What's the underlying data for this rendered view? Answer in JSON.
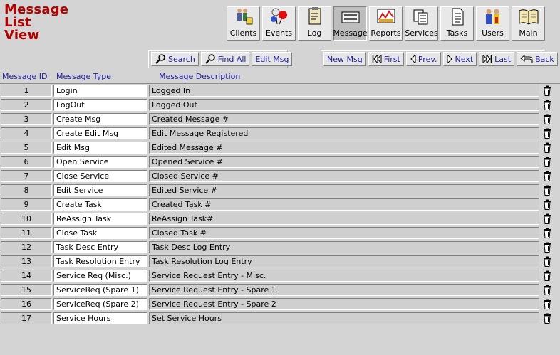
{
  "page": {
    "title_lines": [
      "Message",
      "List",
      "View"
    ]
  },
  "nav": [
    {
      "label": "Clients",
      "icon": "clients-icon",
      "active": false
    },
    {
      "label": "Events",
      "icon": "events-icon",
      "active": false
    },
    {
      "label": "Log",
      "icon": "log-icon",
      "active": false
    },
    {
      "label": "Message",
      "icon": "message-icon",
      "active": true
    },
    {
      "label": "Reports",
      "icon": "reports-icon",
      "active": false
    },
    {
      "label": "Services",
      "icon": "services-icon",
      "active": false
    },
    {
      "label": "Tasks",
      "icon": "tasks-icon",
      "active": false
    },
    {
      "label": "Users",
      "icon": "users-icon",
      "active": false
    },
    {
      "label": "Main",
      "icon": "main-icon",
      "active": false
    }
  ],
  "toolbar": {
    "search": "Search",
    "find_all": "Find All",
    "edit_msg": "Edit Msg",
    "new_msg": "New Msg",
    "first": "First",
    "prev": "Prev.",
    "next": "Next",
    "last": "Last",
    "back": "Back"
  },
  "columns": {
    "id": "Message ID",
    "type": "Message Type",
    "desc": "Message Description"
  },
  "rows": [
    {
      "id": "1",
      "type": "Login",
      "desc": "Logged In"
    },
    {
      "id": "2",
      "type": "LogOut",
      "desc": "Logged Out"
    },
    {
      "id": "3",
      "type": "Create Msg",
      "desc": "Created Message #"
    },
    {
      "id": "4",
      "type": "Create Edit Msg",
      "desc": "Edit Message Registered"
    },
    {
      "id": "5",
      "type": "Edit Msg",
      "desc": "Edited Message #"
    },
    {
      "id": "6",
      "type": "Open Service",
      "desc": "Opened Service #"
    },
    {
      "id": "7",
      "type": "Close Service",
      "desc": "Closed Service #"
    },
    {
      "id": "8",
      "type": "Edit Service",
      "desc": "Edited Service #"
    },
    {
      "id": "9",
      "type": "Create Task",
      "desc": "Created Task #"
    },
    {
      "id": "10",
      "type": "ReAssign Task",
      "desc": "ReAssign Task#"
    },
    {
      "id": "11",
      "type": "Close Task",
      "desc": "Closed Task #"
    },
    {
      "id": "12",
      "type": "Task Desc Entry",
      "desc": "Task Desc Log Entry"
    },
    {
      "id": "13",
      "type": "Task Resolution Entry",
      "desc": "Task Resolution Log Entry"
    },
    {
      "id": "14",
      "type": "Service Req (Misc.)",
      "desc": "Service Request Entry - Misc."
    },
    {
      "id": "15",
      "type": "ServiceReq (Spare 1)",
      "desc": "Service Request Entry - Spare 1"
    },
    {
      "id": "16",
      "type": "ServiceReq (Spare 2)",
      "desc": "Service Request Entry - Spare 2"
    },
    {
      "id": "17",
      "type": "Service Hours",
      "desc": "Set Service Hours"
    }
  ],
  "colors": {
    "title": "#b30000",
    "link_blue": "#1c1ca0",
    "background": "#d4d4d4"
  }
}
